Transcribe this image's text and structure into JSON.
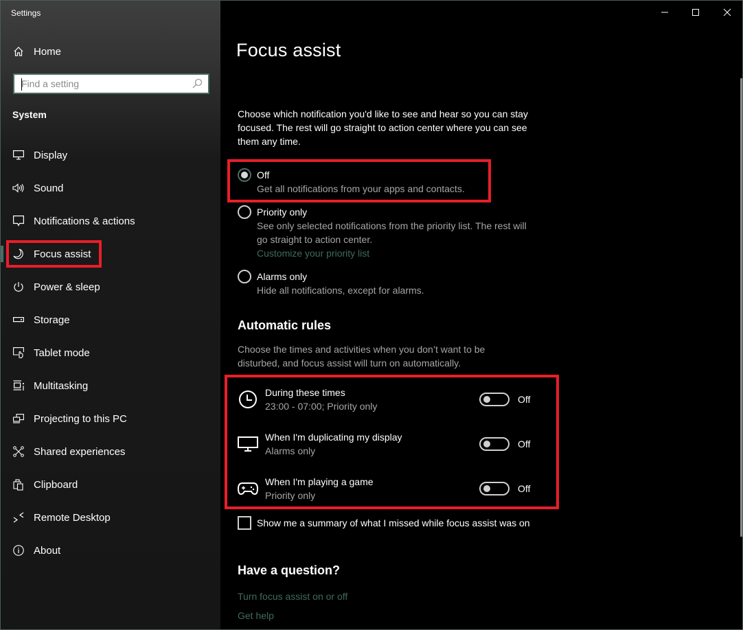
{
  "window": {
    "app_title": "Settings",
    "controls": {
      "minimize": "minimize-icon",
      "maximize": "maximize-icon",
      "close": "close-icon"
    }
  },
  "sidebar": {
    "home_label": "Home",
    "search": {
      "placeholder": "Find a setting",
      "value": ""
    },
    "section_title": "System",
    "items": [
      {
        "label": "Display",
        "icon": "monitor-icon"
      },
      {
        "label": "Sound",
        "icon": "speaker-icon"
      },
      {
        "label": "Notifications & actions",
        "icon": "speech-bubble-icon"
      },
      {
        "label": "Focus assist",
        "icon": "moon-icon",
        "active": true
      },
      {
        "label": "Power & sleep",
        "icon": "power-icon"
      },
      {
        "label": "Storage",
        "icon": "drive-icon"
      },
      {
        "label": "Tablet mode",
        "icon": "tablet-touch-icon"
      },
      {
        "label": "Multitasking",
        "icon": "multitasking-icon"
      },
      {
        "label": "Projecting to this PC",
        "icon": "project-icon"
      },
      {
        "label": "Shared experiences",
        "icon": "shared-icon"
      },
      {
        "label": "Clipboard",
        "icon": "clipboard-icon"
      },
      {
        "label": "Remote Desktop",
        "icon": "remote-desktop-icon"
      },
      {
        "label": "About",
        "icon": "info-icon"
      }
    ]
  },
  "main": {
    "title": "Focus assist",
    "description": "Choose which notification you'd like to see and hear so you can stay focused. The rest will go straight to action center where you can see them any time.",
    "options": [
      {
        "label": "Off",
        "subtitle": "Get all notifications from your apps and contacts.",
        "checked": true
      },
      {
        "label": "Priority only",
        "subtitle": "See only selected notifications from the priority list. The rest will go straight to action center.",
        "link": "Customize your priority list",
        "checked": false
      },
      {
        "label": "Alarms only",
        "subtitle": "Hide all notifications, except for alarms.",
        "checked": false
      }
    ],
    "automatic_rules": {
      "heading": "Automatic rules",
      "description": "Choose the times and activities when you don’t want to be disturbed, and focus assist will turn on automatically.",
      "rules": [
        {
          "title": "During these times",
          "subtitle": "23:00 - 07:00; Priority only",
          "icon": "clock-icon",
          "state": "Off"
        },
        {
          "title": "When I'm duplicating my display",
          "subtitle": "Alarms only",
          "icon": "monitor-icon",
          "state": "Off"
        },
        {
          "title": "When I'm playing a game",
          "subtitle": "Priority only",
          "icon": "gamepad-icon",
          "state": "Off"
        }
      ]
    },
    "summary_checkbox": {
      "label": "Show me a summary of what I missed while focus assist was on",
      "checked": false
    },
    "help": {
      "heading": "Have a question?",
      "links": [
        "Turn focus assist on or off",
        "Get help"
      ]
    }
  },
  "colors": {
    "highlight": "#e81e2a",
    "accent": "#4a6e66",
    "link": "#3f6b5f"
  }
}
